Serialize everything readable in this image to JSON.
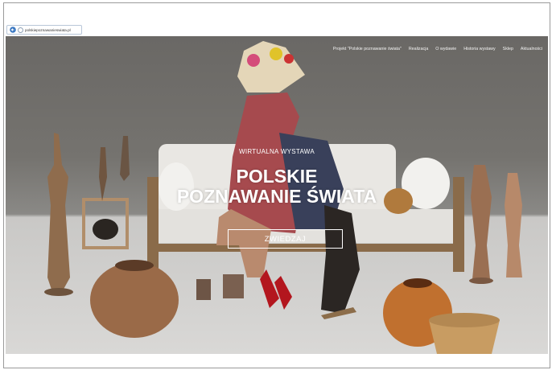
{
  "browser": {
    "url": "polskiepoznawanieswiata.pl"
  },
  "nav": {
    "items": [
      "Projekt \"Polskie poznawanie świata\"",
      "Realizacja",
      "O wydawie",
      "Historia wystawy",
      "Sklep",
      "Aktualności"
    ]
  },
  "hero": {
    "subtitle": "WIRTUALNA WYSTAWA",
    "title_line1": "POLSKIE",
    "title_line2": "POZNAWANIE ŚWIATA",
    "cta_label": "ZWIEDZAJ"
  }
}
